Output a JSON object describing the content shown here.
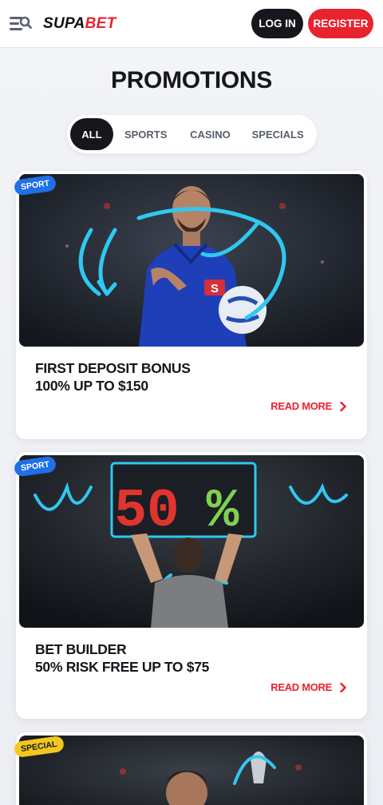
{
  "header": {
    "logo_prefix": "SUPA",
    "logo_suffix": "BET",
    "login_label": "LOG IN",
    "register_label": "REGISTER"
  },
  "page": {
    "title": "PROMOTIONS"
  },
  "filters": [
    {
      "label": "ALL",
      "active": true
    },
    {
      "label": "SPORTS",
      "active": false
    },
    {
      "label": "CASINO",
      "active": false
    },
    {
      "label": "SPECIALS",
      "active": false
    }
  ],
  "promotions": [
    {
      "badge": "SPORT",
      "title_line1": "FIRST DEPOSIT BONUS",
      "title_line2": "100% UP TO $150",
      "read_more": "READ MORE"
    },
    {
      "badge": "SPORT",
      "title_line1": "BET BUILDER",
      "title_line2": "50% RISK FREE UP TO $75",
      "read_more": "READ MORE",
      "image_scoreboard_left": "50",
      "image_scoreboard_right": "%"
    },
    {
      "badge": "SPECIAL"
    }
  ],
  "colors": {
    "brand_red": "#e8232e",
    "dark": "#15171c",
    "sport_badge": "#1f6fe8",
    "special_badge": "#f2c81f",
    "scribble": "#2fc8f0"
  }
}
